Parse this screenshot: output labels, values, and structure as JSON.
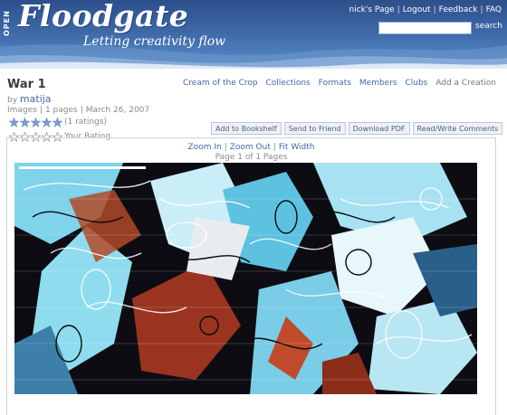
{
  "header": {
    "logo_prefix": "OPEN",
    "logo_name": "Floodgate",
    "tagline": "Letting creativity flow",
    "links": [
      "nick's Page",
      "Logout",
      "Feedback",
      "FAQ"
    ],
    "search_label": "search",
    "search_placeholder": ""
  },
  "nav": [
    "Cream of the Crop",
    "Collections",
    "Formats",
    "Members",
    "Clubs",
    "Add a Creation"
  ],
  "work": {
    "title": "War 1",
    "by": "by",
    "author": "matija",
    "category": "Images",
    "pages": "1 pages",
    "date": "March 26, 2007",
    "ratings_text": "(1 ratings)",
    "your_rating": "Your Rating",
    "average_stars": 5,
    "max_stars": 5
  },
  "actions": [
    "Add to Bookshelf",
    "Send to Friend",
    "Download PDF",
    "Read/Write Comments"
  ],
  "viewer": {
    "zoom_in": "Zoom In",
    "zoom_out": "Zoom Out",
    "fit_width": "Fit Width",
    "page_info": "Page 1 of 1 Pages"
  },
  "colors": {
    "link": "#4267a8",
    "header": "#3d68a6",
    "star_filled": "#7f9fd4",
    "star_empty": "#ffffff"
  }
}
